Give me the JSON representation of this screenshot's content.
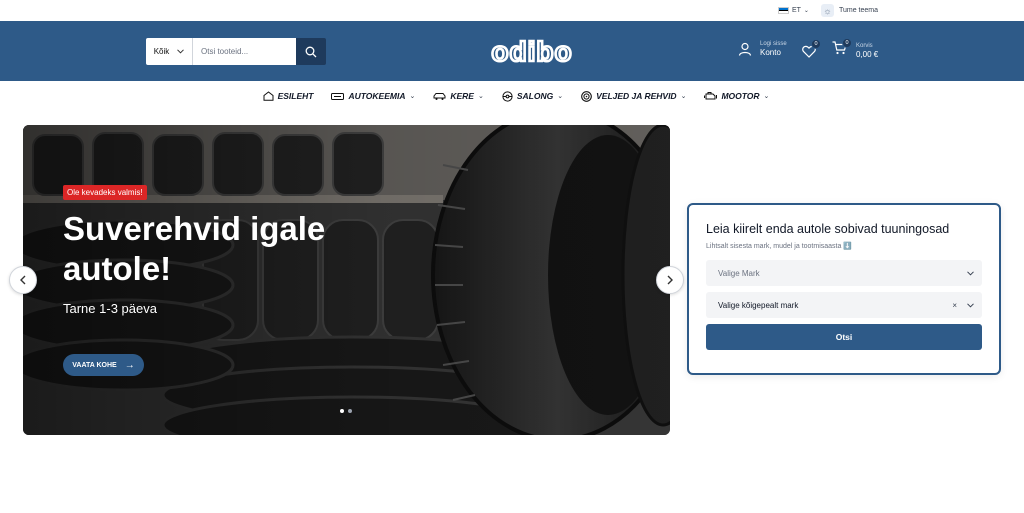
{
  "topbar": {
    "language": "ET",
    "theme_label": "Tume teema"
  },
  "header": {
    "search_category": "Kõik",
    "search_placeholder": "Otsi tooteid...",
    "logo_text": "odibo",
    "account_small": "Logi sisse",
    "account_big": "Konto",
    "wishlist_count": "0",
    "cart_count": "0",
    "cart_small": "Korvis",
    "cart_total": "0,00 €"
  },
  "nav": {
    "items": [
      {
        "label": "ESILEHT"
      },
      {
        "label": "AUTOKEEMIA"
      },
      {
        "label": "KERE"
      },
      {
        "label": "SALONG"
      },
      {
        "label": "VELJED JA REHVID"
      },
      {
        "label": "MOOTOR"
      }
    ]
  },
  "hero": {
    "badge": "Ole kevadeks valmis!",
    "title": "Suverehvid igale autole!",
    "subtitle": "Tarne 1-3 päeva",
    "cta": "VAATA KOHE",
    "cta_arrow": "→",
    "active_slide": 1,
    "slide_count": 2
  },
  "finder": {
    "title": "Leia kiirelt enda autole sobivad tuuningosad",
    "hint": "Lihtsalt sisesta mark, mudel ja tootmisaasta ⬇️",
    "select_brand": "Valige Mark",
    "select_model": "Valige kõigepealt mark",
    "clear_symbol": "×",
    "button": "Otsi"
  },
  "colors": {
    "primary": "#2e5a88",
    "dark_primary": "#1e3a5c",
    "promo_red": "#dc2626"
  }
}
